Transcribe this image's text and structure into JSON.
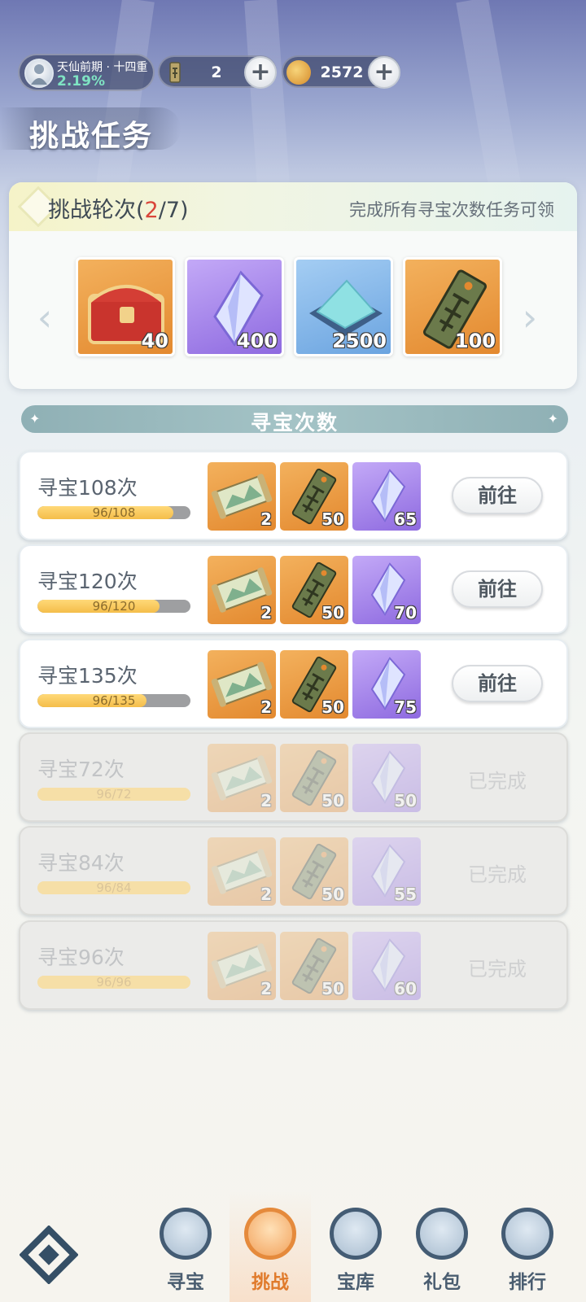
{
  "header": {
    "realm_name": "天仙前期 · 十四重",
    "realm_progress": "2.19%",
    "resource_token": "2",
    "resource_coin": "2572",
    "page_title": "挑战任务"
  },
  "round": {
    "label_prefix": "挑战轮次(",
    "current": "2",
    "label_sep": "/",
    "total": "7",
    "label_suffix": ")",
    "note": "完成所有寻宝次数任务可领",
    "rewards": [
      {
        "item": "chest",
        "count": "40"
      },
      {
        "item": "crystal",
        "count": "400"
      },
      {
        "item": "jade-mound",
        "count": "2500"
      },
      {
        "item": "token",
        "count": "100"
      }
    ]
  },
  "section_title": "寻宝次数",
  "tasks": [
    {
      "name": "寻宝108次",
      "progress": "96/108",
      "fraction": 0.889,
      "rewards": [
        "2",
        "50",
        "65"
      ],
      "action": "前往",
      "done": false
    },
    {
      "name": "寻宝120次",
      "progress": "96/120",
      "fraction": 0.8,
      "rewards": [
        "2",
        "50",
        "70"
      ],
      "action": "前往",
      "done": false
    },
    {
      "name": "寻宝135次",
      "progress": "96/135",
      "fraction": 0.711,
      "rewards": [
        "2",
        "50",
        "75"
      ],
      "action": "前往",
      "done": false
    },
    {
      "name": "寻宝72次",
      "progress": "96/72",
      "fraction": 1.0,
      "rewards": [
        "2",
        "50",
        "50"
      ],
      "action": "已完成",
      "done": true
    },
    {
      "name": "寻宝84次",
      "progress": "96/84",
      "fraction": 1.0,
      "rewards": [
        "2",
        "50",
        "55"
      ],
      "action": "已完成",
      "done": true
    },
    {
      "name": "寻宝96次",
      "progress": "96/96",
      "fraction": 1.0,
      "rewards": [
        "2",
        "50",
        "60"
      ],
      "action": "已完成",
      "done": true
    }
  ],
  "nav": [
    "寻宝",
    "挑战",
    "宝库",
    "礼包",
    "排行"
  ],
  "nav_active": 1
}
